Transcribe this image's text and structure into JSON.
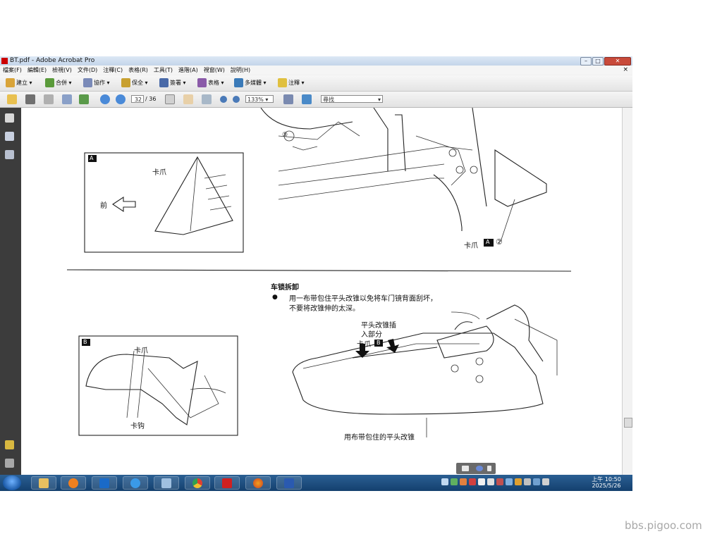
{
  "window": {
    "title": "BT.pdf - Adobe Acrobat Pro",
    "controls": {
      "minimize": "–",
      "maximize": "□",
      "close": "✕"
    }
  },
  "menubar": {
    "items": [
      "檔案(F)",
      "編輯(E)",
      "檢視(V)",
      "文件(D)",
      "注釋(C)",
      "表格(R)",
      "工具(T)",
      "進階(A)",
      "視窗(W)",
      "說明(H)"
    ],
    "close_symbol": "×"
  },
  "toolbar1": {
    "create_label": "建立",
    "combine_label": "合併",
    "collaborate_label": "協作",
    "secure_label": "保全",
    "sign_label": "簽署",
    "forms_label": "表格",
    "multimedia_label": "多媒體",
    "comment_label": "注釋"
  },
  "toolbar2": {
    "page_current": "32",
    "page_total": "/ 36",
    "zoom": "133%",
    "search_placeholder": "尋找"
  },
  "document": {
    "panel_a_badge": "A",
    "panel_a_claw": "卡爪",
    "panel_a_front": "前",
    "claw_a2_label": "卡爪",
    "claw_a2_badge": "A",
    "claw_a2_number": "②",
    "callout_3": "③",
    "section_heading": "车锁拆卸",
    "bullet": "●",
    "instruction_line1": "用一布带包住平头改锥以免将车门镜背面刮坏，",
    "instruction_line2": "不要将改锥伸的太深。",
    "insert_label_line1": "平头改锥插",
    "insert_label_line2": "入部分",
    "claw_b_label": "卡爪",
    "claw_b_badge": "B",
    "panel_b_badge": "B",
    "panel_b_claw": "卡爪",
    "panel_b_hook": "卡钩",
    "screwdriver_label": "用布带包住的平头改锥"
  },
  "taskbar": {
    "apps": [
      "file-explorer",
      "media-player",
      "outlook",
      "internet-explorer",
      "windows-app",
      "chrome",
      "acrobat",
      "firefox",
      "word"
    ],
    "clock_time": "上午 10:50",
    "clock_date": "2025/5/26"
  },
  "watermark": "bbs.pigoo.com",
  "colors": {
    "titlebar": "#c4d5ea",
    "sidebar": "#3c3c3c",
    "taskbar": "#14406e",
    "close_button": "#c84a3a"
  }
}
